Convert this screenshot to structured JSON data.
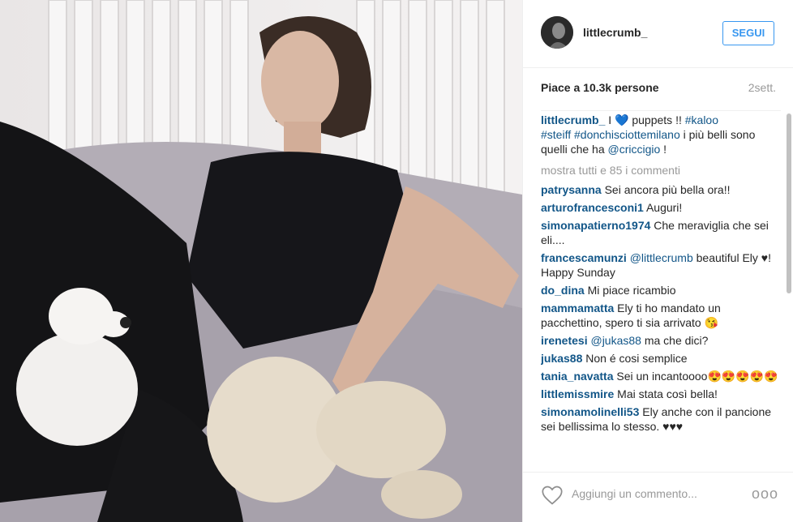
{
  "post": {
    "username": "littlecrumb_",
    "follow_label": "SEGUI",
    "likes": "Piace a 10.3k persone",
    "time": "2sett."
  },
  "caption": {
    "user": "littlecrumb_",
    "part1": " I ",
    "heart": "💙",
    "part2": " puppets !! ",
    "tag1": "#kaloo",
    "tag2": "#steiff",
    "tag3": "#donchisciottemilano",
    "part3": " i più belli sono quelli che ha ",
    "mention": "@criccigio",
    "part4": " !"
  },
  "more_comments": "mostra tutti e 85 i commenti",
  "comments": [
    {
      "user": "patrysanna",
      "text": "Sei ancora più bella ora!!"
    },
    {
      "user": "arturofrancesconi1",
      "text": "Auguri!"
    },
    {
      "user": "simonapatierno1974",
      "text": "Che meraviglia che sei eli...."
    },
    {
      "user": "francescamunzi",
      "mention": "@littlecrumb",
      "text": "beautiful Ely ♥! Happy Sunday"
    },
    {
      "user": "do_dina",
      "text": "Mi piace ricambio"
    },
    {
      "user": "mammamatta",
      "text": "Ely ti ho mandato un pacchettino, spero ti sia arrivato 😘"
    },
    {
      "user": "irenetesi",
      "mention": "@jukas88",
      "text": "ma che dici?"
    },
    {
      "user": "jukas88",
      "text": "Non é cosi semplice"
    },
    {
      "user": "tania_navatta",
      "text": "Sei un incantoooo😍😍😍😍😍"
    },
    {
      "user": "littlemissmire",
      "text": "Mai stata così bella!"
    },
    {
      "user": "simonamolinelli53",
      "text": "Ely anche con il pancione sei bellissima lo stesso. ♥♥♥"
    }
  ],
  "footer": {
    "placeholder": "Aggiungi un commento...",
    "more_icon": "ooo"
  },
  "colors": {
    "link": "#125688",
    "follow": "#3897f0",
    "muted": "#999999"
  }
}
